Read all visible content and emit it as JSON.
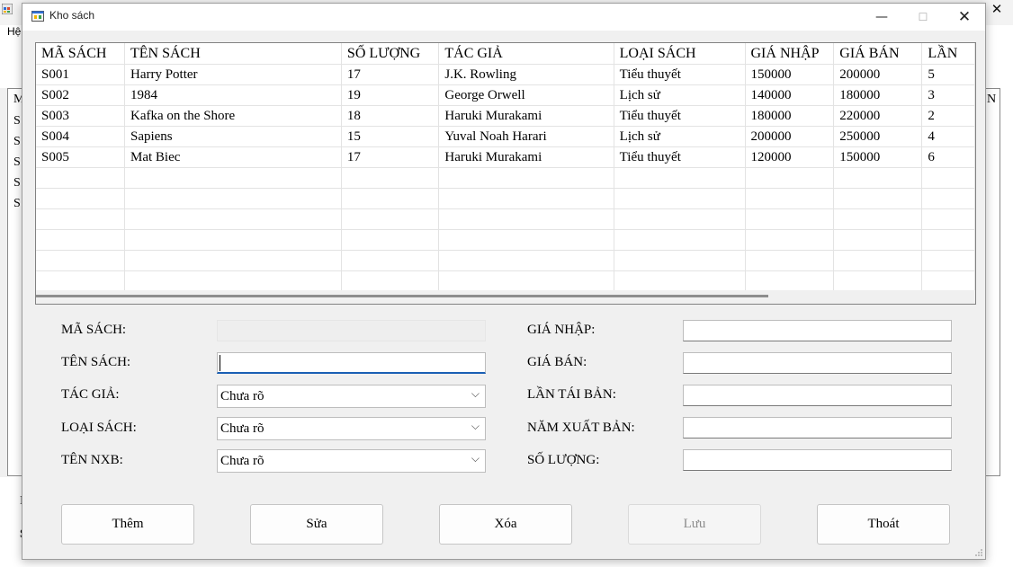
{
  "background_window": {
    "menu_fragment": "Hệ",
    "grid_header_fragment": "M",
    "grid_cell_fragment": "S",
    "grid_header_right_fragment": "N",
    "below_fragment_1": "I",
    "below_fragment_2": "S"
  },
  "dialog": {
    "title": "Kho sách",
    "close_glyph": "✕",
    "minimize_glyph": "—",
    "maximize_glyph": "☐"
  },
  "grid": {
    "columns": [
      "MÃ SÁCH",
      "TÊN SÁCH",
      "SỐ LƯỢNG",
      "TÁC GIẢ",
      "LOẠI SÁCH",
      "GIÁ NHẬP",
      "GIÁ BÁN",
      "LẦN"
    ],
    "rows": [
      [
        "S001",
        "Harry Potter",
        "17",
        "J.K. Rowling",
        "Tiểu thuyết",
        "150000",
        "200000",
        "5"
      ],
      [
        "S002",
        "1984",
        "19",
        "George Orwell",
        "Lịch sử",
        "140000",
        "180000",
        "3"
      ],
      [
        "S003",
        "Kafka on the Shore",
        "18",
        "Haruki Murakami",
        "Tiểu thuyết",
        "180000",
        "220000",
        "2"
      ],
      [
        "S004",
        "Sapiens",
        "15",
        "Yuval Noah Harari",
        "Lịch sử",
        "200000",
        "250000",
        "4"
      ],
      [
        "S005",
        "Mat Biec",
        "17",
        "Haruki Murakami",
        "Tiểu thuyết",
        "120000",
        "150000",
        "6"
      ]
    ]
  },
  "form": {
    "left": {
      "ma_sach_label": "MÃ SÁCH:",
      "ma_sach_value": "",
      "ten_sach_label": "TÊN SÁCH:",
      "ten_sach_value": "",
      "tac_gia_label": "TÁC GIẢ:",
      "tac_gia_value": "Chưa rõ",
      "loai_sach_label": "LOẠI SÁCH:",
      "loai_sach_value": "Chưa rõ",
      "ten_nxb_label": "TÊN NXB:",
      "ten_nxb_value": "Chưa rõ"
    },
    "right": {
      "gia_nhap_label": "GIÁ NHẬP:",
      "gia_nhap_value": "",
      "gia_ban_label": "GIÁ BÁN:",
      "gia_ban_value": "",
      "lan_tai_ban_label": "LẦN TÁI BẢN:",
      "lan_tai_ban_value": "",
      "nam_xuat_ban_label": "NĂM XUẤT BẢN:",
      "nam_xuat_ban_value": "",
      "so_luong_label": "SỐ LƯỢNG:",
      "so_luong_value": ""
    }
  },
  "buttons": {
    "them": "Thêm",
    "sua": "Sửa",
    "xoa": "Xóa",
    "luu": "Lưu",
    "thoat": "Thoát"
  },
  "icons": {
    "app_icon": "app-window-icon",
    "dropdown": "chevron-down-icon",
    "dropdown_glyph": "⌵"
  },
  "colors": {
    "dialog_bg": "#f0f0f0",
    "focus_accent": "#1a5fb4",
    "disabled_text": "#8c8c8c"
  }
}
